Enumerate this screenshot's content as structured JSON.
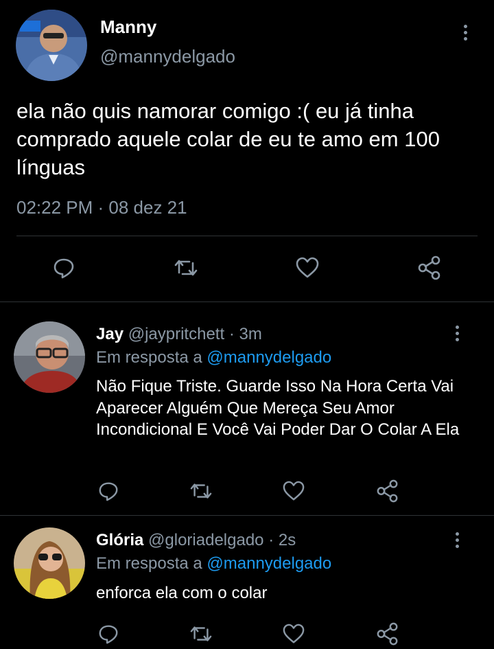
{
  "main_tweet": {
    "author_name": "Manny",
    "author_handle": "@mannydelgado",
    "text": "ela não quis namorar comigo :( eu já tinha comprado aquele colar de eu te amo em 100 línguas",
    "timestamp": "02:22 PM · 08 dez 21",
    "actions": [
      "reply-icon",
      "retweet-icon",
      "like-icon",
      "share-icon"
    ]
  },
  "replies": [
    {
      "author_name": "Jay",
      "author_handle": "@jaypritchett",
      "time": "· 3m",
      "reply_prefix": "Em resposta a",
      "reply_to": "@mannydelgado",
      "text": "Não Fique Triste. Guarde Isso Na Hora Certa Vai Aparecer Alguém Que Mereça Seu Amor Incondicional E Você Vai Poder Dar O Colar A Ela"
    },
    {
      "author_name": "Glória",
      "author_handle": "@gloriadelgado",
      "time": "· 2s",
      "reply_prefix": "Em resposta a",
      "reply_to": "@mannydelgado",
      "text": "enforca ela com o colar"
    }
  ],
  "colors": {
    "background": "#000000",
    "text": "#ffffff",
    "muted": "#8b98a5",
    "link": "#1d9bf0",
    "divider": "#2f3336"
  }
}
